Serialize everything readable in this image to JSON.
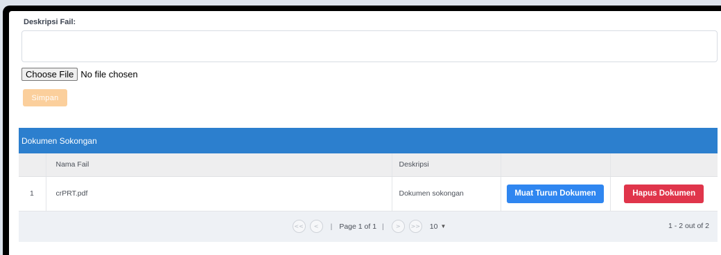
{
  "form": {
    "desc_label": "Deskripsi Fail:",
    "desc_value": "",
    "file_button": "Choose File",
    "file_status": "No file chosen",
    "save_label": "Simpan"
  },
  "table": {
    "title": "Dokumen Sokongan",
    "columns": [
      "",
      "Nama Fail",
      "Deskripsi",
      "",
      ""
    ],
    "rows": [
      {
        "no": "1",
        "name": "crPRT.pdf",
        "desc": "Dokumen sokongan",
        "download_label": "Muat Turun Dokumen",
        "delete_label": "Hapus Dokumen"
      }
    ]
  },
  "pager": {
    "first": "<<",
    "prev": "<",
    "next": ">",
    "last": ">>",
    "page_text": "Page 1 of 1",
    "sep": "|",
    "page_size": "10",
    "count": "1 - 2 out of 2"
  },
  "colors": {
    "table_header": "#2c7fce",
    "download_button": "#2f86f0",
    "delete_button": "#e0354b",
    "save_button": "#fbcf9c"
  }
}
